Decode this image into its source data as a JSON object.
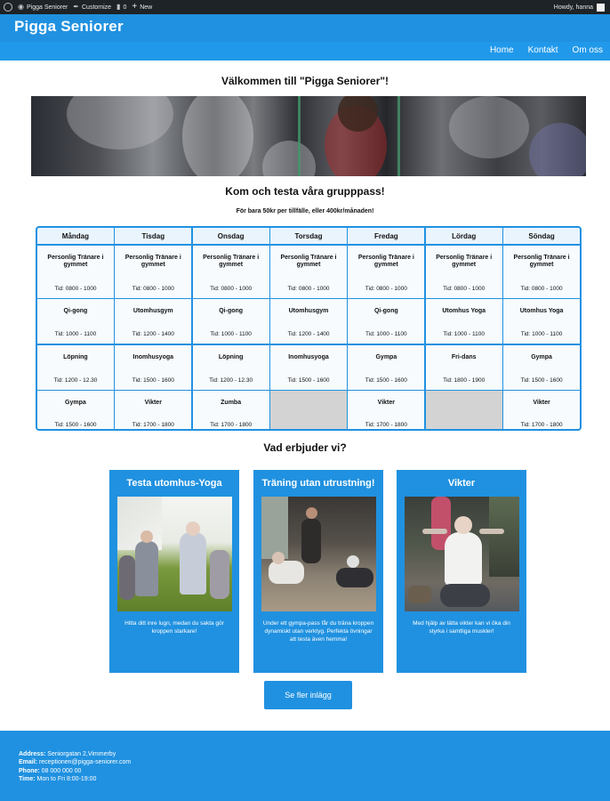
{
  "adminbar": {
    "site": "Pigga Seniorer",
    "customize": "Customize",
    "comments": "0",
    "new": "New",
    "howdy": "Howdy, hanna"
  },
  "header": {
    "title": "Pigga Seniorer",
    "nav": [
      "Home",
      "Kontakt",
      "Om oss"
    ]
  },
  "main": {
    "welcome": "Välkommen till \"Pigga Seniorer\"!",
    "subtitle": "Kom och testa våra grupppass!",
    "price": "För bara 50kr per tillfälle, eller 400kr/månaden!"
  },
  "schedule": {
    "days": [
      "Måndag",
      "Tisdag",
      "Onsdag",
      "Torsdag",
      "Fredag",
      "Lördag",
      "Söndag"
    ],
    "rows": [
      [
        {
          "name": "Personlig Tränare i gymmet",
          "time": "Tid: 0800 - 1000"
        },
        {
          "name": "Personlig Tränare i gymmet",
          "time": "Tid: 0800 - 1000"
        },
        {
          "name": "Personlig Tränare i gymmet",
          "time": "Tid: 0800 - 1000"
        },
        {
          "name": "Personlig Tränare i gymmet",
          "time": "Tid: 0800 - 1000"
        },
        {
          "name": "Personlig Tränare i gymmet",
          "time": "Tid: 0800 - 1000"
        },
        {
          "name": "Personlig Tränare i gymmet",
          "time": "Tid: 0800 - 1000"
        },
        {
          "name": "Personlig Tränare i gymmet",
          "time": "Tid: 0800 - 1000"
        }
      ],
      [
        {
          "name": "Qi-gong",
          "time": "Tid: 1000 - 1100"
        },
        {
          "name": "Utomhusgym",
          "time": "Tid: 1200 - 1400"
        },
        {
          "name": "Qi-gong",
          "time": "Tid: 1000 - 1100"
        },
        {
          "name": "Utomhusgym",
          "time": "Tid: 1200 - 1400"
        },
        {
          "name": "Qi-gong",
          "time": "Tid: 1000 - 1100"
        },
        {
          "name": "Utomhus Yoga",
          "time": "Tid: 1000 - 1100"
        },
        {
          "name": "Utomhus Yoga",
          "time": "Tid: 1000 - 1100"
        }
      ],
      [
        {
          "name": "Löpning",
          "time": "Tid: 1200 - 12.30"
        },
        {
          "name": "Inomhusyoga",
          "time": "Tid: 1500 - 1600"
        },
        {
          "name": "Löpning",
          "time": "Tid: 1200 - 12.30"
        },
        {
          "name": "Inomhusyoga",
          "time": "Tid: 1500 - 1600"
        },
        {
          "name": "Gympa",
          "time": "Tid: 1500 - 1600"
        },
        {
          "name": "Fri-dans",
          "time": "Tid: 1800 - 1900"
        },
        {
          "name": "Gympa",
          "time": "Tid: 1500 - 1600"
        }
      ],
      [
        {
          "name": "Gympa",
          "time": "Tid: 1500 - 1600"
        },
        {
          "name": "Vikter",
          "time": "Tid: 1700 - 1800"
        },
        {
          "name": "Zumba",
          "time": "Tid: 1700 - 1800"
        },
        {
          "name": "",
          "time": ""
        },
        {
          "name": "Vikter",
          "time": "Tid: 1700 - 1800"
        },
        {
          "name": "",
          "time": ""
        },
        {
          "name": "Vikter",
          "time": "Tid: 1700 - 1800"
        }
      ]
    ]
  },
  "offers": {
    "title": "Vad erbjuder vi?",
    "cards": [
      {
        "title": "Testa utomhus-Yoga",
        "desc": "Hitta ditt inre lugn, medan du sakta gör kroppen starkare!"
      },
      {
        "title": "Träning utan utrustning!",
        "desc": "Under ett gympa-pass får du träna kroppen dynamiskt utan verktyg. Perfekta övningar att testa även hemma!"
      },
      {
        "title": "Vikter",
        "desc": "Med hjälp av lätta vikter kan vi öka din styrka i samtliga muskler!"
      }
    ],
    "more_button": "Se fler inlägg"
  },
  "footer": {
    "address_label": "Address:",
    "address": " Seniorgatan 2,Vimmerby",
    "email_label": "Email:",
    "email": " receptionen@pigga-seniorer.com",
    "phone_label": "Phone:",
    "phone": " 08 000 000 00",
    "time_label": "Time:",
    "time": " Mon to Fri 8:00-19:00"
  },
  "colors": {
    "brand_blue": "#2091e0",
    "adminbar": "#1d2327",
    "empty_cell": "#d3d3d3"
  }
}
